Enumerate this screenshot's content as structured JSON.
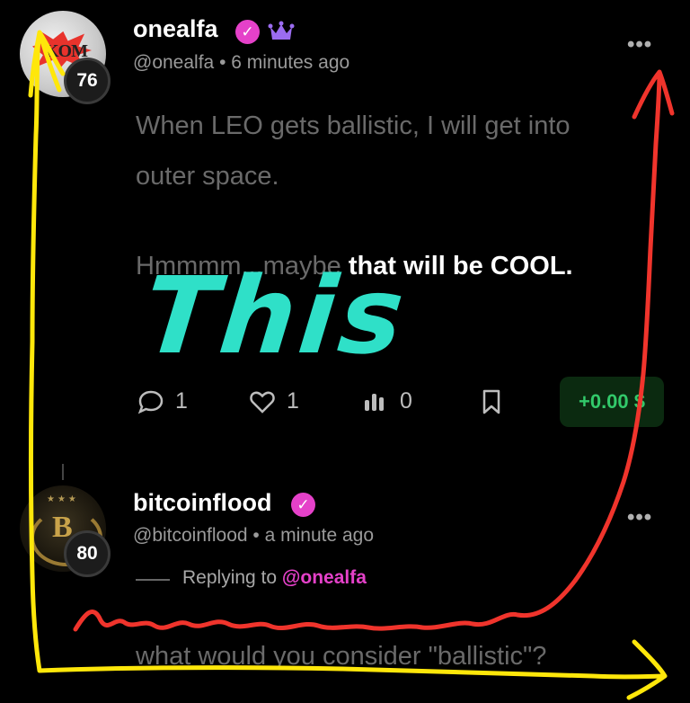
{
  "post1": {
    "username": "onealfa",
    "handle": "@onealfa",
    "separator": "•",
    "time": "6 minutes ago",
    "level": "76",
    "text_line1": "When LEO gets ballistic, I will get into",
    "text_line2": "outer space.",
    "text_line3_dim": "Hmmmm...maybe",
    "text_line3_bold": "that will be COOL.",
    "actions": {
      "comments": "1",
      "likes": "1",
      "views": "0"
    },
    "tip_label": "+0.00 $",
    "icons": {
      "verified": "verified-check-icon",
      "crown": "crown-icon",
      "more": "more-horizontal-icon",
      "comment": "comment-icon",
      "like": "heart-icon",
      "views": "bar-chart-icon",
      "bookmark": "bookmark-icon"
    }
  },
  "post2": {
    "username": "bitcoinflood",
    "handle": "@bitcoinflood",
    "separator": "•",
    "time": "a minute ago",
    "level": "80",
    "replying_prefix": "Replying to",
    "replying_to": "@onealfa",
    "text": "what would you consider \"ballistic\"?"
  },
  "annotation": {
    "handwritten_text": "This",
    "colors": {
      "this_text": "#2fe0c8",
      "yellow_arrow": "#ffe70a",
      "red_arrow": "#f0342c"
    }
  },
  "colors": {
    "background": "#000000",
    "accent_pink": "#e541c9",
    "tip_green": "#32c96a",
    "crown_purple": "#9b6cf0"
  }
}
